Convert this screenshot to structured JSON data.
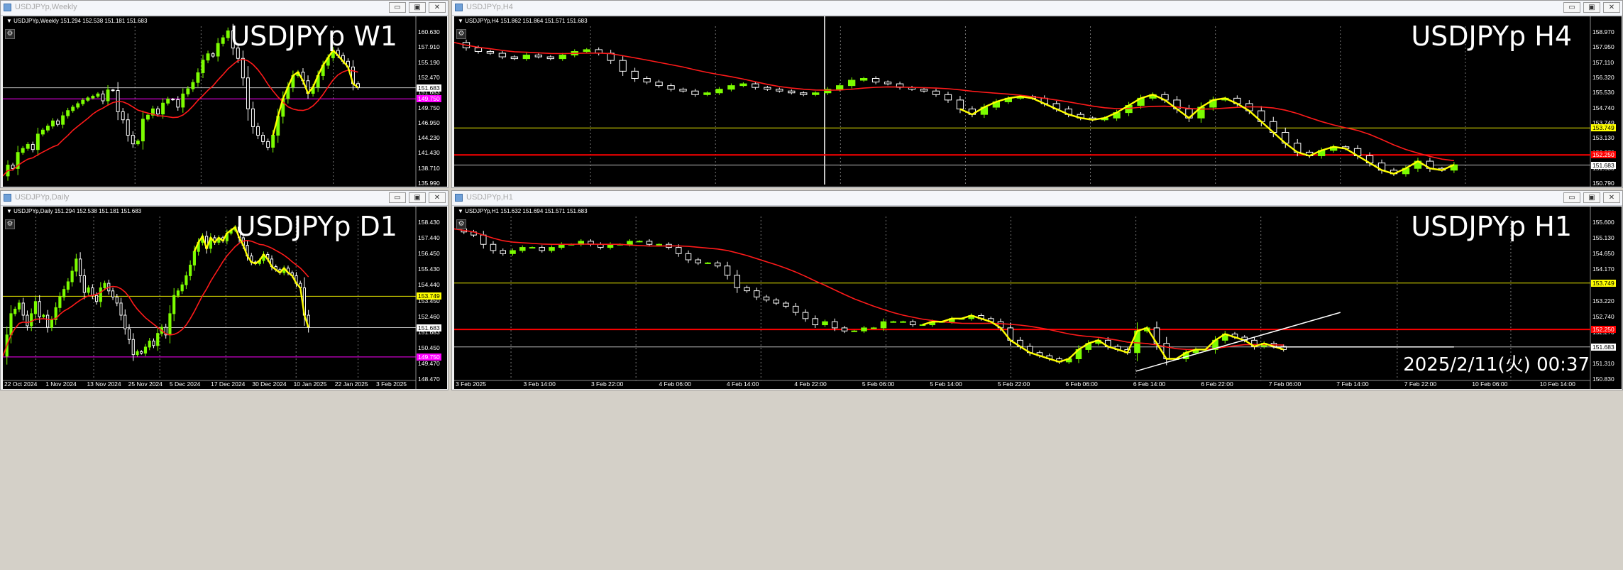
{
  "windows": [
    {
      "key": "w1",
      "title": "USDJPYp,Weekly",
      "ohlc": "▼ USDJPYp,Weekly  151.294 152.538 151.181 151.683",
      "big_label": "USDJPYp W1",
      "timestamp": "",
      "price_labels": [
        "160.630",
        "157.910",
        "155.190",
        "152.470",
        "151.683",
        "149.750",
        "146.950",
        "144.230",
        "141.430",
        "138.710",
        "135.990"
      ],
      "boxes": [
        {
          "text": "151.683",
          "fg": "#000000",
          "bg": "#ffffff",
          "price": 151.683
        },
        {
          "text": "149.750",
          "fg": "#ffffff",
          "bg": "#ff00ff",
          "price": 149.75
        }
      ],
      "time_labels": []
    },
    {
      "key": "h4",
      "title": "USDJPYp,H4",
      "ohlc": "▼ USDJPYp,H4  151.862 151.864 151.571 151.683",
      "big_label": "USDJPYp H4",
      "timestamp": "",
      "price_labels": [
        "158.970",
        "157.950",
        "157.110",
        "156.320",
        "155.530",
        "154.740",
        "153.749",
        "153.130",
        "152.370",
        "151.683",
        "150.790"
      ],
      "boxes": [
        {
          "text": "153.749",
          "fg": "#000000",
          "bg": "#ffff00",
          "price": 153.749
        },
        {
          "text": "152.250",
          "fg": "#ffffff",
          "bg": "#ff0000",
          "price": 152.25
        },
        {
          "text": "151.683",
          "fg": "#000000",
          "bg": "#ffffff",
          "price": 151.683
        }
      ],
      "time_labels": []
    },
    {
      "key": "d1",
      "title": "USDJPYp,Daily",
      "ohlc": "▼ USDJPYp,Daily  151.294 152.538 151.181 151.683",
      "big_label": "USDJPYp D1",
      "timestamp": "",
      "price_labels": [
        "158.430",
        "157.440",
        "156.450",
        "155.430",
        "154.440",
        "153.450",
        "152.460",
        "151.683",
        "150.450",
        "149.470",
        "148.470"
      ],
      "boxes": [
        {
          "text": "153.749",
          "fg": "#000000",
          "bg": "#ffff00",
          "price": 153.749
        },
        {
          "text": "151.683",
          "fg": "#000000",
          "bg": "#ffffff",
          "price": 151.683
        },
        {
          "text": "149.750",
          "fg": "#ffffff",
          "bg": "#ff00ff",
          "price": 149.75
        }
      ],
      "time_labels": [
        "22 Oct 2024",
        "1 Nov 2024",
        "13 Nov 2024",
        "25 Nov 2024",
        "5 Dec 2024",
        "17 Dec 2024",
        "30 Dec 2024",
        "10 Jan 2025",
        "22 Jan 2025",
        "3 Feb 2025"
      ]
    },
    {
      "key": "h1",
      "title": "USDJPYp,H1",
      "ohlc": "▼ USDJPYp,H1  151.632 151.694 151.571 151.683",
      "big_label": "USDJPYp H1",
      "timestamp": "2025/2/11(火) 00:37",
      "price_labels": [
        "155.600",
        "155.130",
        "154.650",
        "154.170",
        "153.749",
        "153.220",
        "152.740",
        "152.270",
        "151.683",
        "151.310",
        "150.830"
      ],
      "boxes": [
        {
          "text": "153.749",
          "fg": "#000000",
          "bg": "#ffff00",
          "price": 153.749
        },
        {
          "text": "152.250",
          "fg": "#ffffff",
          "bg": "#ff0000",
          "price": 152.25
        },
        {
          "text": "151.683",
          "fg": "#000000",
          "bg": "#ffffff",
          "price": 151.683
        }
      ],
      "time_labels": [
        "3 Feb 2025",
        "3 Feb 14:00",
        "3 Feb 22:00",
        "4 Feb 06:00",
        "4 Feb 14:00",
        "4 Feb 22:00",
        "5 Feb 06:00",
        "5 Feb 14:00",
        "5 Feb 22:00",
        "6 Feb 06:00",
        "6 Feb 14:00",
        "6 Feb 22:00",
        "7 Feb 06:00",
        "7 Feb 14:00",
        "7 Feb 22:00",
        "10 Feb 06:00",
        "10 Feb 14:00"
      ]
    }
  ],
  "window_buttons": {
    "minimize": "▭",
    "maximize": "▣",
    "close": "✕"
  },
  "colors": {
    "bull": "#7cfc00",
    "bear": "#ffffff",
    "ma": "#ff1a1a",
    "zigzag": "#ffff00",
    "level_yellow": "#e8e800",
    "level_magenta": "#ff00ff",
    "level_red": "#ff0000",
    "level_gray": "#c0c0c0"
  },
  "chart_data": [
    {
      "type": "candlestick",
      "symbol": "USDJPYp",
      "timeframe": "W1",
      "price_range": [
        134.8,
        162.4
      ],
      "levels": [
        {
          "price": 151.683,
          "color": "gray"
        },
        {
          "price": 149.75,
          "color": "magenta"
        }
      ],
      "path": [
        136.3,
        138.2,
        137.6,
        140.4,
        141.1,
        141.8,
        140.9,
        143.6,
        144.3,
        145.0,
        145.9,
        145.3,
        146.8,
        147.7,
        148.3,
        148.9,
        149.5,
        149.9,
        150.2,
        150.6,
        149.4,
        151.3,
        151.2,
        147.5,
        146.1,
        143.4,
        141.9,
        142.4,
        146.2,
        146.9,
        148.0,
        147.1,
        149.0,
        149.7,
        149.6,
        148.3,
        150.6,
        151.5,
        152.6,
        154.3,
        156.5,
        157.6,
        157.2,
        159.4,
        160.4,
        161.6,
        158.6,
        156.8,
        153.4,
        148.0,
        144.9,
        143.4,
        142.3,
        141.3,
        143.4,
        146.7,
        149.8,
        151.8,
        153.8,
        154.4,
        152.9,
        150.7,
        151.8,
        153.8,
        155.6,
        156.9,
        158.2,
        157.3,
        156.3,
        155.3,
        152.4,
        151.7
      ]
    },
    {
      "type": "candlestick",
      "symbol": "USDJPYp",
      "timeframe": "H4",
      "price_range": [
        150.6,
        159.4
      ],
      "levels": [
        {
          "price": 153.749,
          "color": "yellow"
        },
        {
          "price": 152.25,
          "color": "red"
        },
        {
          "price": 151.683,
          "color": "gray"
        }
      ],
      "path": [
        158.5,
        158.2,
        158.0,
        157.9,
        157.7,
        157.6,
        157.8,
        157.7,
        157.6,
        157.8,
        158.0,
        158.1,
        157.9,
        157.5,
        156.9,
        156.5,
        156.3,
        156.1,
        155.9,
        155.8,
        155.6,
        155.7,
        155.9,
        156.1,
        156.2,
        156.0,
        155.9,
        155.8,
        155.7,
        155.6,
        155.7,
        155.9,
        156.1,
        156.4,
        156.5,
        156.3,
        156.2,
        156.0,
        155.9,
        155.8,
        155.6,
        155.3,
        154.8,
        154.5,
        154.9,
        155.2,
        155.4,
        155.5,
        155.4,
        155.1,
        154.8,
        154.5,
        154.3,
        154.2,
        154.3,
        154.6,
        155.0,
        155.4,
        155.6,
        155.3,
        154.8,
        154.3,
        154.9,
        155.3,
        155.4,
        155.1,
        154.7,
        154.1,
        153.5,
        152.9,
        152.4,
        152.2,
        152.5,
        152.7,
        152.6,
        152.2,
        151.8,
        151.4,
        151.2,
        151.5,
        151.9,
        151.5,
        151.4,
        151.7
      ]
    },
    {
      "type": "candlestick",
      "symbol": "USDJPYp",
      "timeframe": "D1",
      "price_range": [
        148.2,
        159.0
      ],
      "levels": [
        {
          "price": 153.749,
          "color": "yellow"
        },
        {
          "price": 151.683,
          "color": "gray"
        },
        {
          "price": 149.75,
          "color": "magenta"
        }
      ],
      "path": [
        149.8,
        151.2,
        152.6,
        152.9,
        153.3,
        152.5,
        151.8,
        152.6,
        153.4,
        152.4,
        152.5,
        151.7,
        152.2,
        153.0,
        153.7,
        154.2,
        154.7,
        155.4,
        156.2,
        155.1,
        154.0,
        154.3,
        153.8,
        153.4,
        154.3,
        154.6,
        154.1,
        153.7,
        153.3,
        152.5,
        151.6,
        150.9,
        149.9,
        150.1,
        150.0,
        150.4,
        150.8,
        150.5,
        151.3,
        151.7,
        151.2,
        152.6,
        153.8,
        154.1,
        154.5,
        155.1,
        155.8,
        156.7,
        157.3,
        157.7,
        156.9,
        157.6,
        157.3,
        157.6,
        157.4,
        157.9,
        158.1,
        158.3,
        157.6,
        157.1,
        156.4,
        156.0,
        155.9,
        156.1,
        156.5,
        156.2,
        155.7,
        155.5,
        155.3,
        155.6,
        155.3,
        155.1,
        154.6,
        154.3,
        152.5,
        151.7
      ]
    },
    {
      "type": "candlestick",
      "symbol": "USDJPYp",
      "timeframe": "H1",
      "price_range": [
        150.6,
        155.9
      ],
      "levels": [
        {
          "price": 153.749,
          "color": "yellow"
        },
        {
          "price": 152.25,
          "color": "red"
        },
        {
          "price": 151.683,
          "color": "gray"
        }
      ],
      "path": [
        155.5,
        155.4,
        155.3,
        155.0,
        154.8,
        154.7,
        154.8,
        154.9,
        154.9,
        154.8,
        154.9,
        155.0,
        155.0,
        155.1,
        155.0,
        154.9,
        155.0,
        155.0,
        155.1,
        155.1,
        155.0,
        155.0,
        154.9,
        154.7,
        154.5,
        154.4,
        154.4,
        154.3,
        154.0,
        153.6,
        153.5,
        153.3,
        153.2,
        153.1,
        153.0,
        152.8,
        152.6,
        152.4,
        152.5,
        152.3,
        152.2,
        152.2,
        152.3,
        152.3,
        152.5,
        152.5,
        152.5,
        152.4,
        152.4,
        152.5,
        152.5,
        152.6,
        152.6,
        152.7,
        152.6,
        152.5,
        152.3,
        151.9,
        151.7,
        151.5,
        151.4,
        151.3,
        151.2,
        151.3,
        151.6,
        151.8,
        151.9,
        151.7,
        151.6,
        151.5,
        152.2,
        152.3,
        151.8,
        151.3,
        151.3,
        151.5,
        151.6,
        151.6,
        151.9,
        152.1,
        152.0,
        151.9,
        151.7,
        151.8,
        151.7,
        151.6
      ]
    }
  ]
}
